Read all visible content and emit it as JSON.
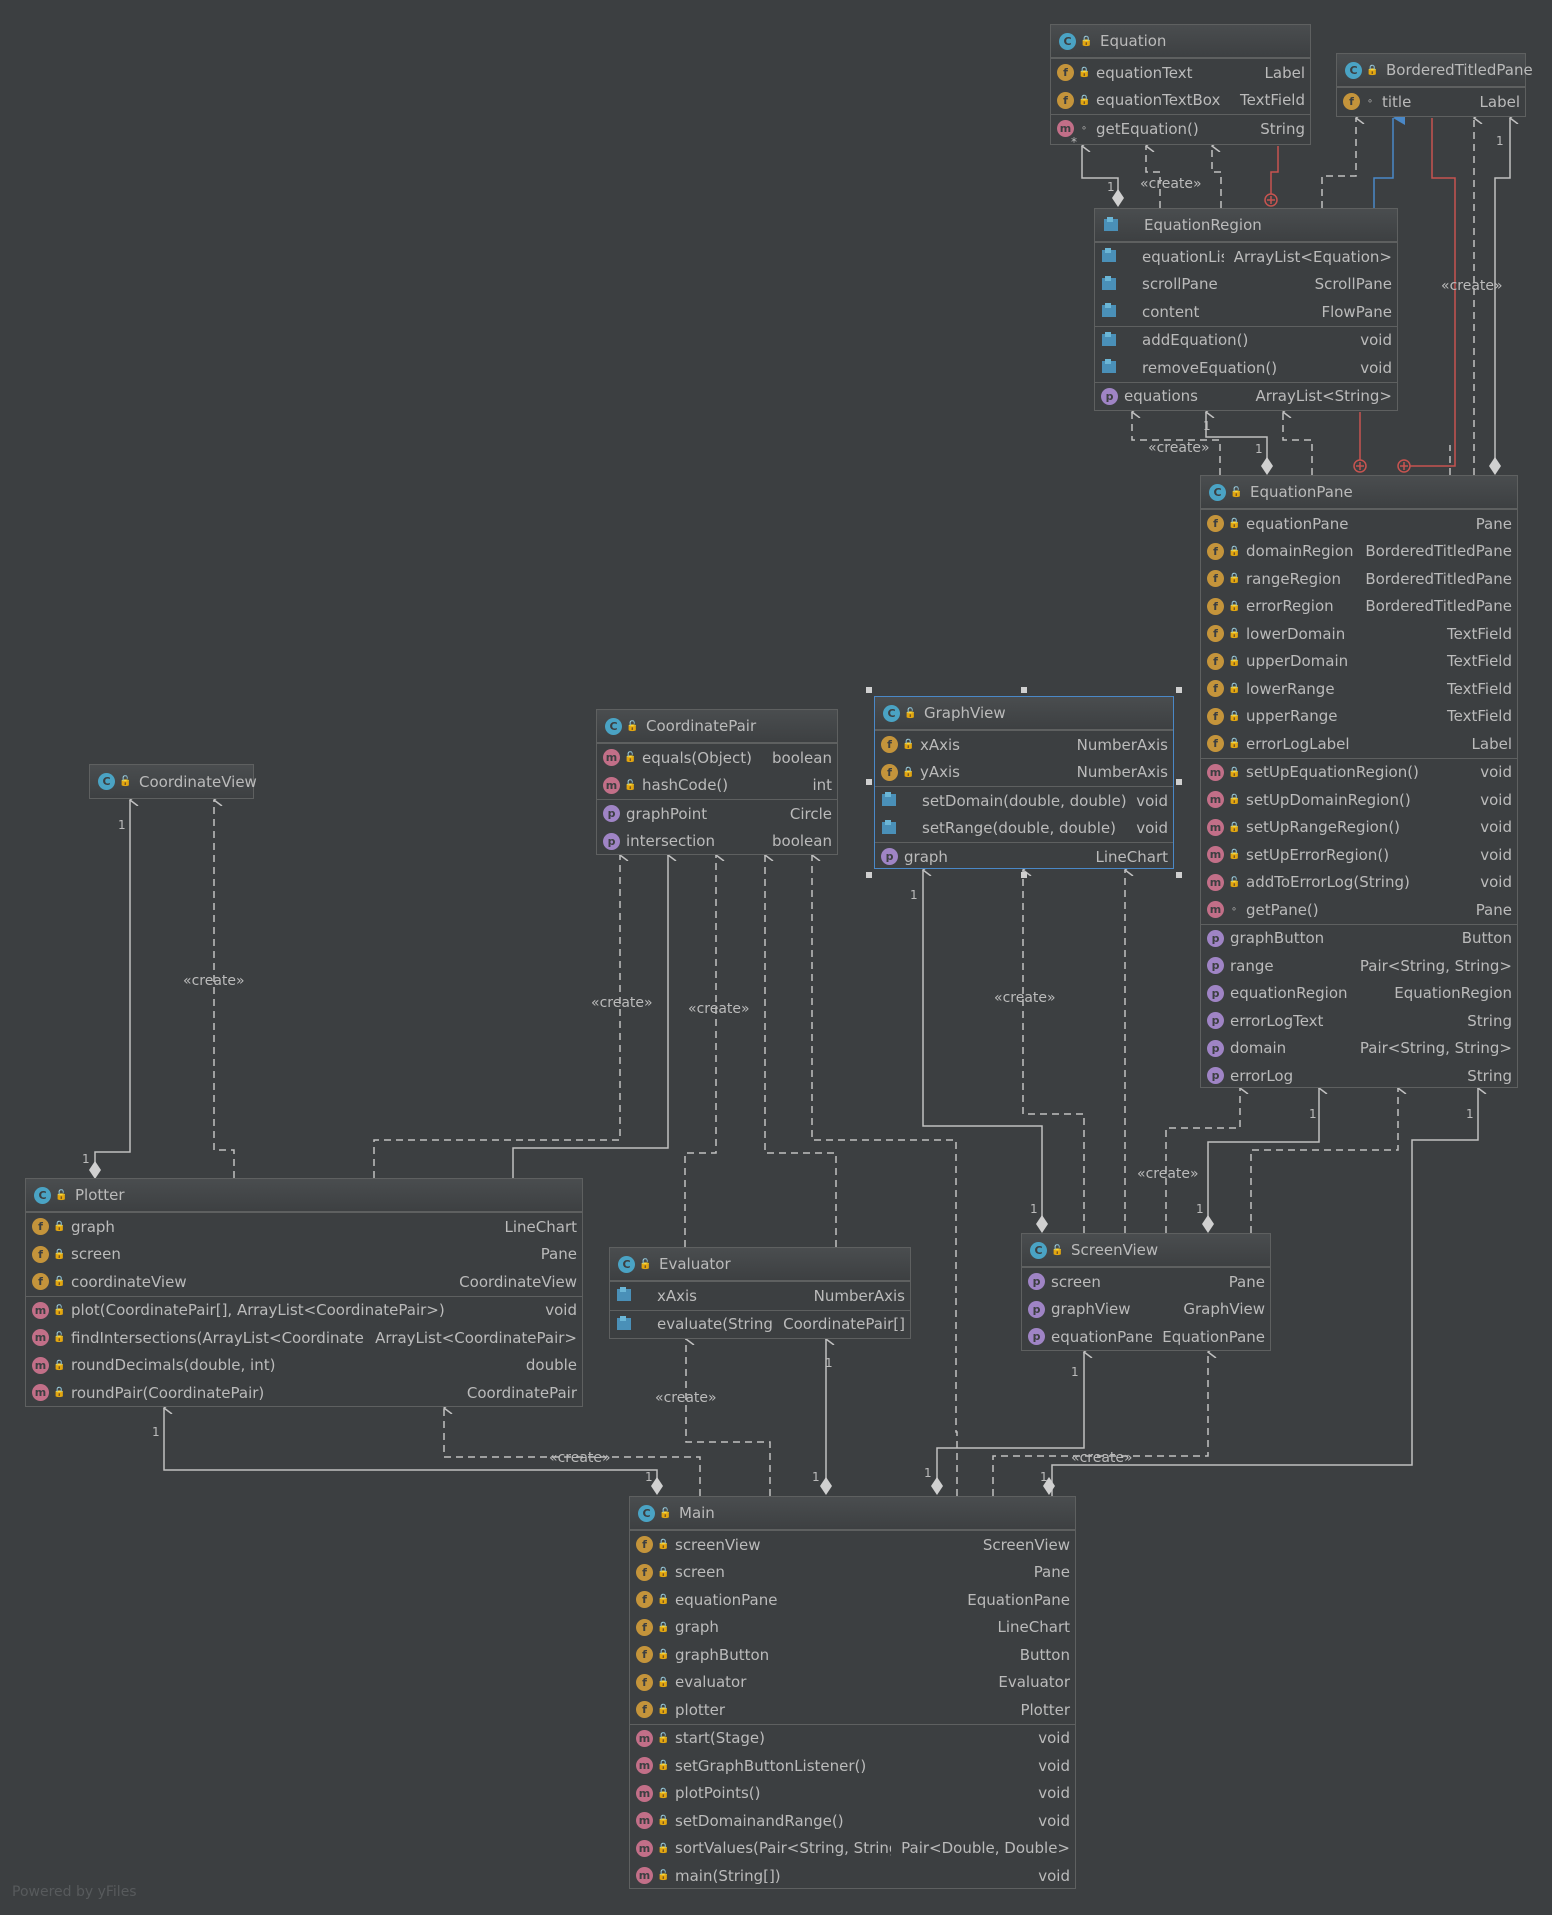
{
  "classes": {
    "equation": {
      "name": "Equation",
      "fields": [
        {
          "name": "equationText",
          "type": "Label"
        },
        {
          "name": "equationTextBox",
          "type": "TextField"
        }
      ],
      "methods": [
        {
          "name": "getEquation()",
          "type": "String"
        }
      ]
    },
    "bordered": {
      "name": "BorderedTitledPane",
      "fields": [
        {
          "name": "title",
          "type": "Label"
        }
      ]
    },
    "region": {
      "name": "EquationRegion",
      "fields": [
        {
          "name": "equationList",
          "type": "ArrayList<Equation>"
        },
        {
          "name": "scrollPane",
          "type": "ScrollPane"
        },
        {
          "name": "content",
          "type": "FlowPane"
        }
      ],
      "methods": [
        {
          "name": "addEquation()",
          "type": "void"
        },
        {
          "name": "removeEquation()",
          "type": "void"
        }
      ],
      "props": [
        {
          "name": "equations",
          "type": "ArrayList<String>"
        }
      ]
    },
    "eqpane": {
      "name": "EquationPane",
      "fields": [
        {
          "name": "equationPane",
          "type": "Pane"
        },
        {
          "name": "domainRegion",
          "type": "BorderedTitledPane"
        },
        {
          "name": "rangeRegion",
          "type": "BorderedTitledPane"
        },
        {
          "name": "errorRegion",
          "type": "BorderedTitledPane"
        },
        {
          "name": "lowerDomain",
          "type": "TextField"
        },
        {
          "name": "upperDomain",
          "type": "TextField"
        },
        {
          "name": "lowerRange",
          "type": "TextField"
        },
        {
          "name": "upperRange",
          "type": "TextField"
        },
        {
          "name": "errorLogLabel",
          "type": "Label"
        }
      ],
      "methods": [
        {
          "name": "setUpEquationRegion()",
          "type": "void"
        },
        {
          "name": "setUpDomainRegion()",
          "type": "void"
        },
        {
          "name": "setUpRangeRegion()",
          "type": "void"
        },
        {
          "name": "setUpErrorRegion()",
          "type": "void"
        },
        {
          "name": "addToErrorLog(String)",
          "type": "void"
        },
        {
          "name": "getPane()",
          "type": "Pane"
        }
      ],
      "props": [
        {
          "name": "graphButton",
          "type": "Button"
        },
        {
          "name": "range",
          "type": "Pair<String, String>"
        },
        {
          "name": "equationRegion",
          "type": "EquationRegion"
        },
        {
          "name": "errorLogText",
          "type": "String"
        },
        {
          "name": "domain",
          "type": "Pair<String, String>"
        },
        {
          "name": "errorLog",
          "type": "String"
        }
      ]
    },
    "coordview": {
      "name": "CoordinateView"
    },
    "pair": {
      "name": "CoordinatePair",
      "methods": [
        {
          "name": "equals(Object)",
          "type": "boolean"
        },
        {
          "name": "hashCode()",
          "type": "int"
        }
      ],
      "props": [
        {
          "name": "graphPoint",
          "type": "Circle"
        },
        {
          "name": "intersection",
          "type": "boolean"
        }
      ]
    },
    "graphview": {
      "name": "GraphView",
      "fields": [
        {
          "name": "xAxis",
          "type": "NumberAxis"
        },
        {
          "name": "yAxis",
          "type": "NumberAxis"
        }
      ],
      "methods": [
        {
          "name": "setDomain(double, double)",
          "type": "void"
        },
        {
          "name": "setRange(double, double)",
          "type": "void"
        }
      ],
      "props": [
        {
          "name": "graph",
          "type": "LineChart"
        }
      ]
    },
    "plotter": {
      "name": "Plotter",
      "fields": [
        {
          "name": "graph",
          "type": "LineChart"
        },
        {
          "name": "screen",
          "type": "Pane"
        },
        {
          "name": "coordinateView",
          "type": "CoordinateView"
        }
      ],
      "methods": [
        {
          "name": "plot(CoordinatePair[], ArrayList<CoordinatePair>)",
          "type": "void"
        },
        {
          "name": "findIntersections(ArrayList<CoordinatePair>)",
          "type": "ArrayList<CoordinatePair>"
        },
        {
          "name": "roundDecimals(double, int)",
          "type": "double"
        },
        {
          "name": "roundPair(CoordinatePair)",
          "type": "CoordinatePair"
        }
      ]
    },
    "evaluator": {
      "name": "Evaluator",
      "fields": [
        {
          "name": "xAxis",
          "type": "NumberAxis"
        }
      ],
      "methods": [
        {
          "name": "evaluate(String)",
          "type": "CoordinatePair[]"
        }
      ]
    },
    "screenview": {
      "name": "ScreenView",
      "props": [
        {
          "name": "screen",
          "type": "Pane"
        },
        {
          "name": "graphView",
          "type": "GraphView"
        },
        {
          "name": "equationPane",
          "type": "EquationPane"
        }
      ]
    },
    "main": {
      "name": "Main",
      "fields": [
        {
          "name": "screenView",
          "type": "ScreenView"
        },
        {
          "name": "screen",
          "type": "Pane"
        },
        {
          "name": "equationPane",
          "type": "EquationPane"
        },
        {
          "name": "graph",
          "type": "LineChart"
        },
        {
          "name": "graphButton",
          "type": "Button"
        },
        {
          "name": "evaluator",
          "type": "Evaluator"
        },
        {
          "name": "plotter",
          "type": "Plotter"
        }
      ],
      "methods": [
        {
          "name": "start(Stage)",
          "type": "void"
        },
        {
          "name": "setGraphButtonListener()",
          "type": "void"
        },
        {
          "name": "plotPoints()",
          "type": "void"
        },
        {
          "name": "setDomainandRange()",
          "type": "void"
        },
        {
          "name": "sortValues(Pair<String, String>)",
          "type": "Pair<Double, Double>"
        },
        {
          "name": "main(String[])",
          "type": "void"
        }
      ]
    }
  },
  "labels": {
    "create": "«create»",
    "one": "1",
    "star": "*"
  },
  "footer": "Powered by yFiles",
  "colors": {
    "background": "#3c3f41",
    "edge": "#c0c0c0",
    "inheritance": "#4a88c7",
    "nested": "#c75450"
  }
}
